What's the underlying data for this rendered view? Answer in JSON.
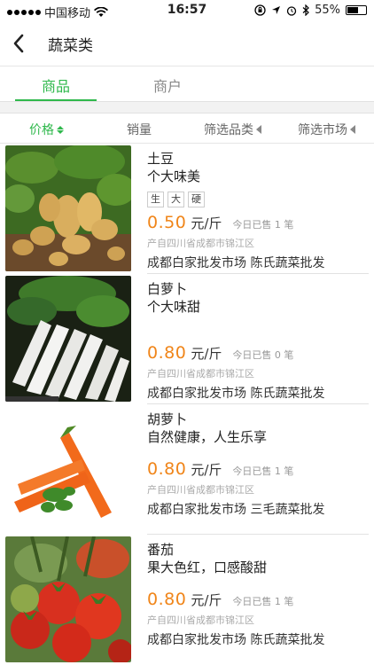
{
  "status_bar": {
    "carrier": "中国移动",
    "time": "16:57",
    "battery": "55%",
    "icons": [
      "signal-dots-icon",
      "wifi-icon",
      "rotation-lock-icon",
      "location-icon",
      "alarm-icon",
      "bluetooth-icon",
      "battery-icon"
    ]
  },
  "nav": {
    "title": "蔬菜类",
    "back_icon": "back-chevron-icon"
  },
  "tabs": [
    {
      "label": "商品",
      "active": true
    },
    {
      "label": "商户",
      "active": false
    }
  ],
  "filters": [
    {
      "label": "价格",
      "active": true,
      "icon": "sort-icon"
    },
    {
      "label": "销量",
      "active": false
    },
    {
      "label": "筛选品类",
      "active": false,
      "icon": "triangle-left-icon"
    },
    {
      "label": "筛选市场",
      "active": false,
      "icon": "triangle-left-icon"
    }
  ],
  "colors": {
    "accent_green": "#2fb84c",
    "price_orange": "#f08519"
  },
  "products": [
    {
      "name": "土豆",
      "desc": "个大味美",
      "tags": [
        "生",
        "大",
        "硬"
      ],
      "price": "0.50",
      "unit": "元/斤",
      "sold": "今日已售 1 笔",
      "origin": "产自四川省成都市锦江区",
      "market": "成都白家批发市场 陈氏蔬菜批发",
      "image": "potato"
    },
    {
      "name": "白萝卜",
      "desc": "个大味甜",
      "tags": [],
      "price": "0.80",
      "unit": "元/斤",
      "sold": "今日已售 0 笔",
      "origin": "产自四川省成都市锦江区",
      "market": "成都白家批发市场 陈氏蔬菜批发",
      "image": "white-radish"
    },
    {
      "name": "胡萝卜",
      "desc": "自然健康，人生乐享",
      "tags": [],
      "price": "0.80",
      "unit": "元/斤",
      "sold": "今日已售 1 笔",
      "origin": "产自四川省成都市锦江区",
      "market": "成都白家批发市场 三毛蔬菜批发",
      "image": "carrot"
    },
    {
      "name": "番茄",
      "desc": "果大色红，口感酸甜",
      "tags": [],
      "price": "0.80",
      "unit": "元/斤",
      "sold": "今日已售 1 笔",
      "origin": "产自四川省成都市锦江区",
      "market": "成都白家批发市场 陈氏蔬菜批发",
      "image": "tomato"
    }
  ]
}
